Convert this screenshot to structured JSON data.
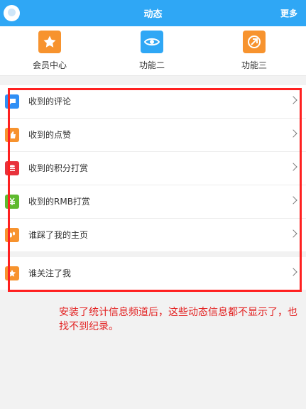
{
  "header": {
    "title": "动态",
    "more_label": "更多"
  },
  "shortcuts": [
    {
      "label": "会员中心",
      "icon": "star-icon",
      "color": "#f7932e"
    },
    {
      "label": "功能二",
      "icon": "eye-icon",
      "color": "#2fa7f5"
    },
    {
      "label": "功能三",
      "icon": "link-icon",
      "color": "#f7932e"
    }
  ],
  "list_group_1": [
    {
      "label": "收到的评论",
      "icon": "comment-icon",
      "color": "#2f8ff5"
    },
    {
      "label": "收到的点赞",
      "icon": "thumbs-up-icon",
      "color": "#f7932e"
    },
    {
      "label": "收到的积分打赏",
      "icon": "coins-icon",
      "color": "#e8323c"
    },
    {
      "label": "收到的RMB打赏",
      "icon": "money-icon",
      "color": "#5fba2e"
    },
    {
      "label": "谁踩了我的主页",
      "icon": "footprint-icon",
      "color": "#f7932e"
    }
  ],
  "list_group_2": [
    {
      "label": "谁关注了我",
      "icon": "star-icon",
      "color": "#f7932e"
    }
  ],
  "annotation": "安装了统计信息频道后，这些动态信息都不显示了，也找不到纪录。"
}
